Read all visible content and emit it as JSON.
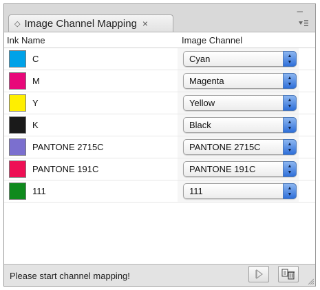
{
  "panel": {
    "tab_arrows": "◇",
    "title": "Image Channel Mapping",
    "close_glyph": "×",
    "collapse_glyph": "–",
    "menu_glyph": "≡"
  },
  "columns": {
    "ink_name": "Ink Name",
    "image_channel": "Image Channel"
  },
  "rows": [
    {
      "ink": "C",
      "swatch": "#00a2e8",
      "channel": "Cyan"
    },
    {
      "ink": "M",
      "swatch": "#e8087a",
      "channel": "Magenta"
    },
    {
      "ink": "Y",
      "swatch": "#ffef00",
      "channel": "Yellow"
    },
    {
      "ink": "K",
      "swatch": "#1a1a1a",
      "channel": "Black"
    },
    {
      "ink": "PANTONE 2715C",
      "swatch": "#7b6fcf",
      "channel": "PANTONE 2715C"
    },
    {
      "ink": "PANTONE 191C",
      "swatch": "#ee1055",
      "channel": "PANTONE 191C"
    },
    {
      "ink": "111",
      "swatch": "#0f8a1d",
      "channel": "111"
    }
  ],
  "status": {
    "message": "Please start channel mapping!"
  },
  "icons": {
    "run": "play-icon",
    "delete": "delete-icon",
    "select_arrows": "up-down-arrows-icon"
  },
  "colors": {
    "select_button": "#2f6fd9",
    "panel_bg": "#d9d9d9"
  }
}
